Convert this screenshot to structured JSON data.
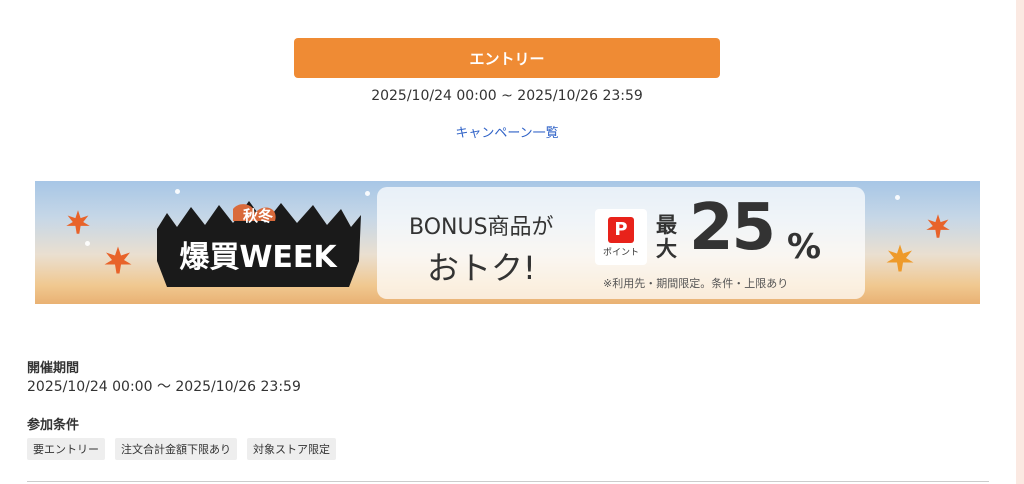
{
  "entry": {
    "button_label": "エントリー",
    "period": "2025/10/24 00:00 ~ 2025/10/26 23:59",
    "campaign_list_link": "キャンペーン一覧"
  },
  "banner": {
    "logo_season": "秋冬",
    "logo_title": "爆買WEEK",
    "promo_line1": "BONUS商品が",
    "promo_line2": "おトク!",
    "point_badge_label": "ポイント",
    "point_mark": "P",
    "max_label": "最大",
    "max_value": "25",
    "max_unit": "%",
    "note": "※利用先・期間限定。条件・上限あり",
    "colors": {
      "sky": "#a7c6e6",
      "sunset": "#e9b173",
      "leaf": "#e8632a",
      "point_red": "#e8221a"
    }
  },
  "details": {
    "period_heading": "開催期間",
    "period_value": "2025/10/24 00:00 〜 2025/10/26 23:59",
    "conditions_heading": "参加条件",
    "conditions": [
      "要エントリー",
      "注文合計金額下限あり",
      "対象ストア限定"
    ]
  },
  "colors": {
    "entry_button": "#ef8b34",
    "link": "#2f62c7"
  }
}
